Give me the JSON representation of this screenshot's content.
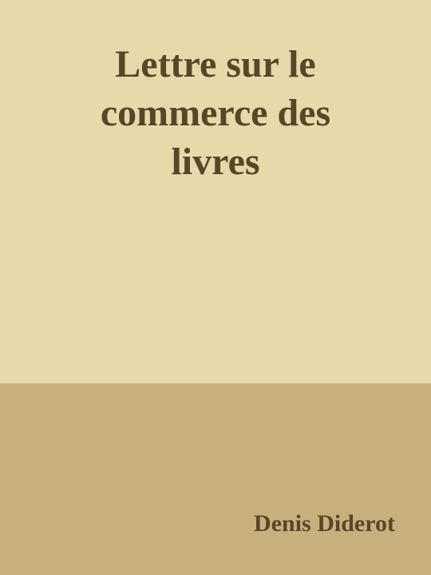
{
  "cover": {
    "title_lines": [
      "Lettre sur le",
      "commerce des",
      "livres"
    ],
    "author": "Denis Diderot",
    "colors": {
      "top_background": "#e6d9aa",
      "bottom_background": "#c8b07e",
      "text": "#574628"
    }
  }
}
